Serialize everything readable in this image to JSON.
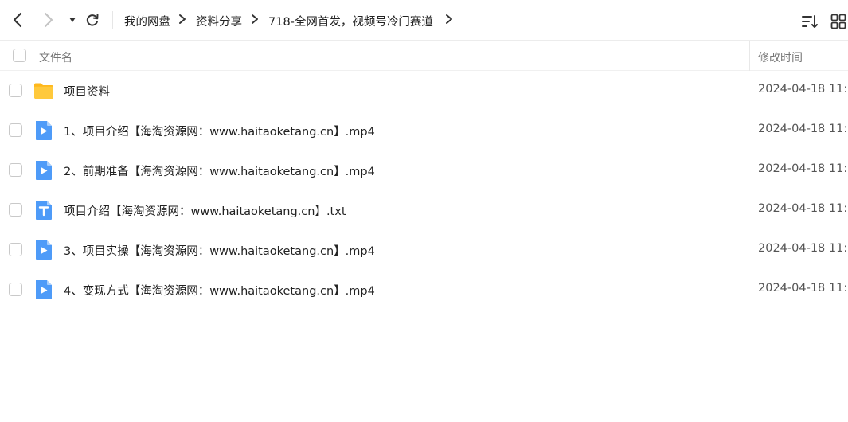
{
  "toolbar": {
    "breadcrumbs": [
      "我的网盘",
      "资料分享",
      "718-全网首发，视频号冷门赛道"
    ]
  },
  "header": {
    "name_label": "文件名",
    "time_label": "修改时间"
  },
  "files": [
    {
      "name": "项目资料",
      "time": "2024-04-18 11:",
      "icon": "folder-icon"
    },
    {
      "name": "1、项目介绍【海淘资源网：www.haitaoketang.cn】.mp4",
      "time": "2024-04-18 11:",
      "icon": "video-file-icon"
    },
    {
      "name": "2、前期准备【海淘资源网：www.haitaoketang.cn】.mp4",
      "time": "2024-04-18 11:",
      "icon": "video-file-icon"
    },
    {
      "name": "项目介绍【海淘资源网：www.haitaoketang.cn】.txt",
      "time": "2024-04-18 11:",
      "icon": "text-file-icon"
    },
    {
      "name": "3、项目实操【海淘资源网：www.haitaoketang.cn】.mp4",
      "time": "2024-04-18 11:",
      "icon": "video-file-icon"
    },
    {
      "name": "4、变现方式【海淘资源网：www.haitaoketang.cn】.mp4",
      "time": "2024-04-18 11:",
      "icon": "video-file-icon"
    }
  ],
  "colors": {
    "folder": "#FFC93C",
    "file_blue": "#4E9BF8"
  }
}
